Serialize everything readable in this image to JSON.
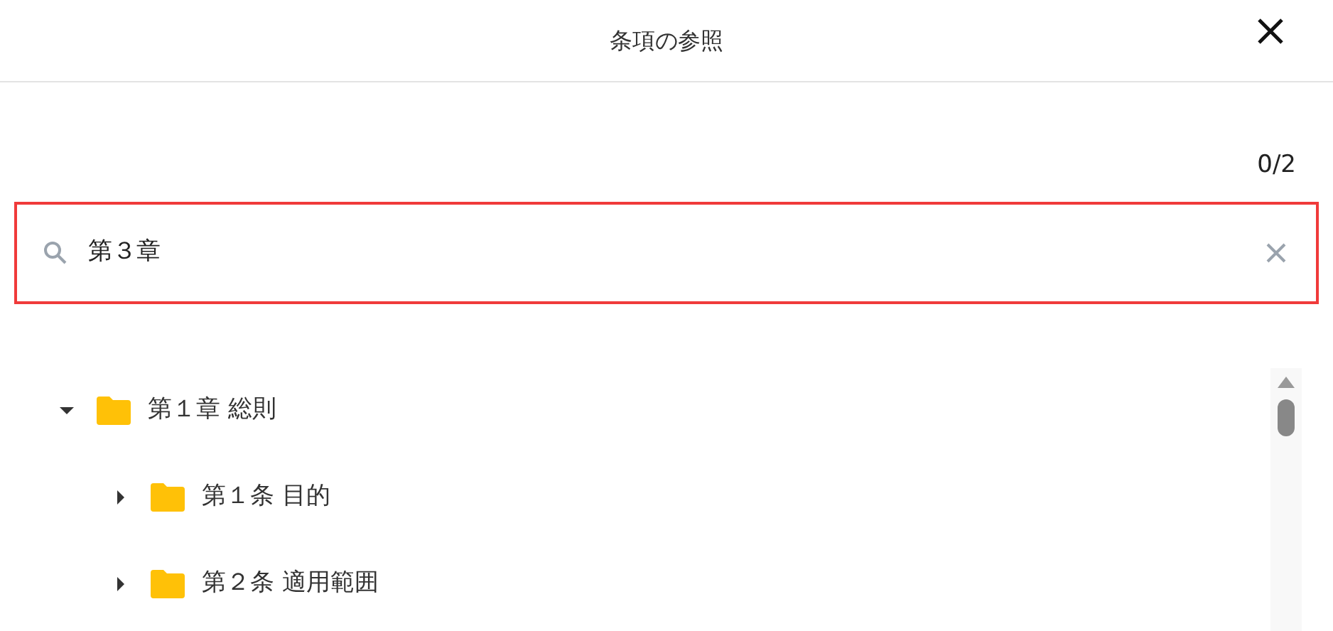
{
  "dialog": {
    "title": "条項の参照"
  },
  "search": {
    "match_count": "0/2",
    "value": "第３章",
    "highlighted": true
  },
  "tree": [
    {
      "label": "第１章 総則",
      "expanded": true,
      "children": [
        {
          "label": "第１条 目的",
          "expanded": false
        },
        {
          "label": "第２条 適用範囲",
          "expanded": false
        }
      ]
    }
  ]
}
